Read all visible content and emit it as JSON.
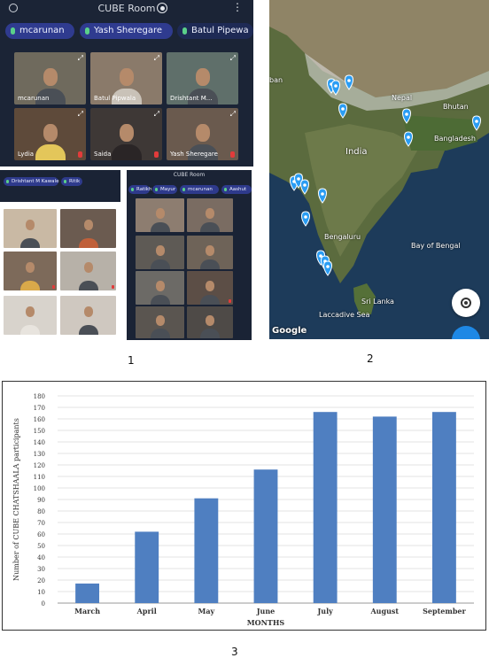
{
  "panel1": {
    "app_title": "CUBE Room",
    "participants_bar": [
      "mcarunan",
      "Yash Sheregare",
      "Batul Pipewa"
    ],
    "tiles": [
      {
        "name": "mcarunan",
        "muted": false
      },
      {
        "name": "Batul Pipwala",
        "muted": false
      },
      {
        "name": "Drishtant M...",
        "muted": false
      },
      {
        "name": "Lydia",
        "muted": true
      },
      {
        "name": "Saida",
        "muted": true
      },
      {
        "name": "Yash Sheregare",
        "muted": true
      }
    ],
    "left_chips": [
      "Drishtant M Kawale",
      "Ritik"
    ],
    "right_title": "CUBE Room",
    "right_chips": [
      "Ratikh",
      "Mayur",
      "mcarunan",
      "Aashut"
    ]
  },
  "panel2": {
    "labels": {
      "nepal": "Nepal",
      "bhutan": "Bhutan",
      "bangladesh": "Bangladesh",
      "india": "India",
      "bengaluru": "Bengaluru",
      "bay": "Bay of Bengal",
      "srilanka": "Sri Lanka",
      "laccadive": "Laccadive Sea",
      "edge": "ban"
    },
    "brand": "Google"
  },
  "captions": {
    "one": "1",
    "two": "2",
    "three": "3"
  },
  "chart_data": {
    "type": "bar",
    "categories": [
      "March",
      "April",
      "May",
      "June",
      "July",
      "August",
      "September"
    ],
    "values": [
      17,
      62,
      91,
      116,
      166,
      162,
      166
    ],
    "xlabel": "MONTHS",
    "ylabel": "Number of CUBE CHATSHAALA participants",
    "ylim": [
      0,
      180
    ],
    "yticks": [
      0,
      10,
      20,
      30,
      40,
      50,
      60,
      70,
      80,
      90,
      100,
      110,
      120,
      130,
      140,
      150,
      160,
      170,
      180
    ],
    "grid": true,
    "bar_color": "#4f7fc1"
  }
}
